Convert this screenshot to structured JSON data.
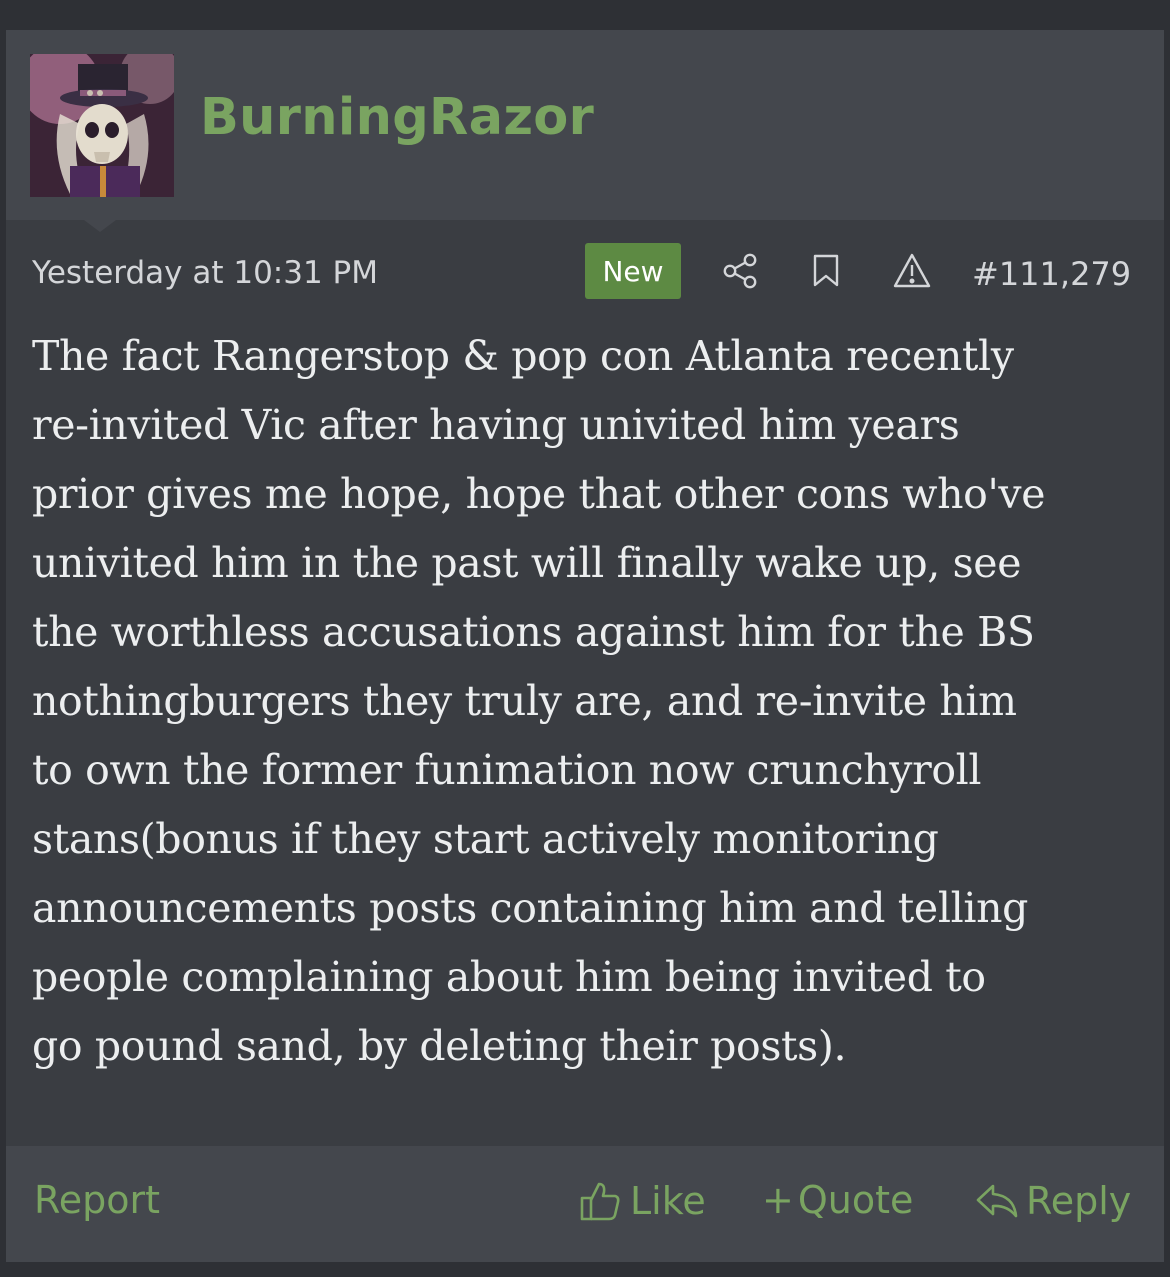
{
  "post": {
    "username": "BurningRazor",
    "timestamp": "Yesterday at 10:31 PM",
    "badge": "New",
    "post_number": "#111,279",
    "body_lines": [
      "The fact Rangerstop & pop con Atlanta recently",
      "re-invited Vic after having univited him years",
      "prior gives me hope, hope that other cons who've",
      "univited him in the past will finally wake up, see",
      "the worthless accusations against him for the BS",
      "nothingburgers they truly are, and re-invite him",
      "to own the former funimation now crunchyroll",
      "stans(bonus if they start actively monitoring",
      "announcements posts containing him and telling",
      "people complaining about him being invited to",
      "go pound sand, by deleting their posts)."
    ]
  },
  "meta_icons": [
    "share-icon",
    "bookmark-icon",
    "warning-icon"
  ],
  "footer": {
    "report_label": "Report",
    "like_label": "Like",
    "quote_plus": "+",
    "quote_label": "Quote",
    "reply_label": "Reply"
  },
  "colors": {
    "accent_green": "#7aa461",
    "badge_green": "#5d8a43",
    "panel_bg": "#3a3d42",
    "band_bg": "#44474d",
    "text": "#eceeef"
  }
}
